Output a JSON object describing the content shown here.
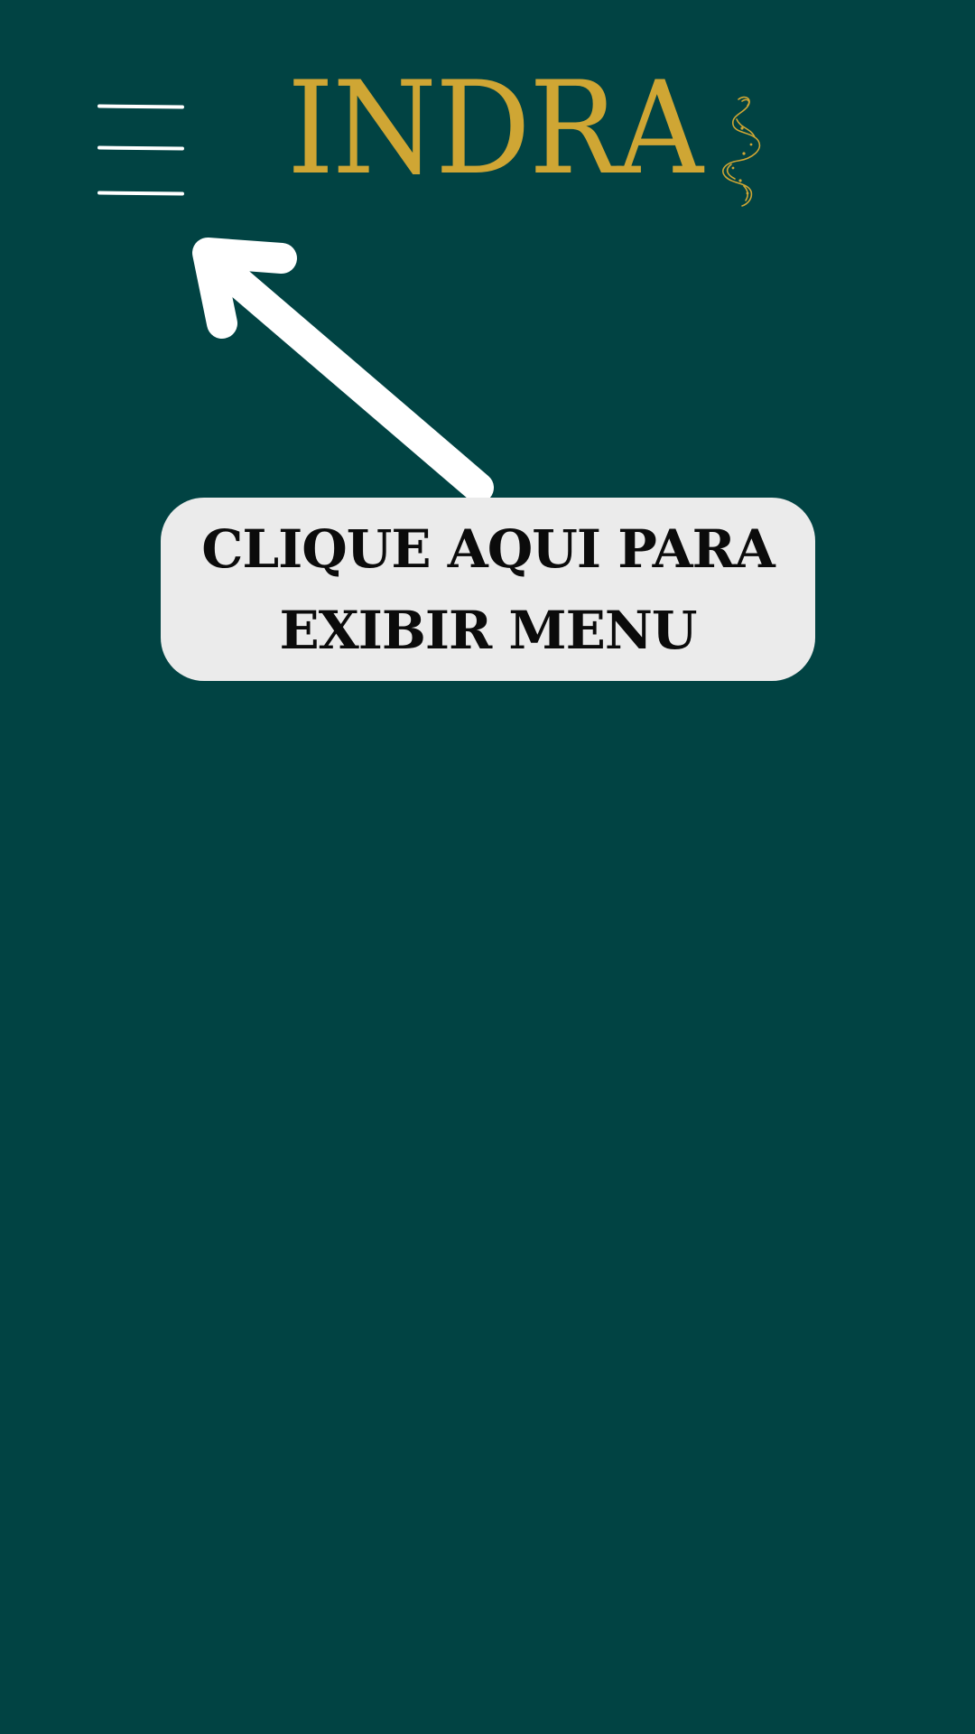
{
  "brand": {
    "name": "INDRA",
    "color": "#cfa634",
    "logo_icon": "snake-icon"
  },
  "header": {
    "menu_icon": "hamburger-menu-icon"
  },
  "callout": {
    "text": "CLIQUE AQUI PARA EXIBIR MENU",
    "arrow_icon": "arrow-up-left-icon"
  },
  "colors": {
    "background": "#014343",
    "callout_background": "#ebebeb",
    "menu_lines": "#ffffff",
    "arrow": "#ffffff",
    "callout_text": "#0b0b0b"
  }
}
